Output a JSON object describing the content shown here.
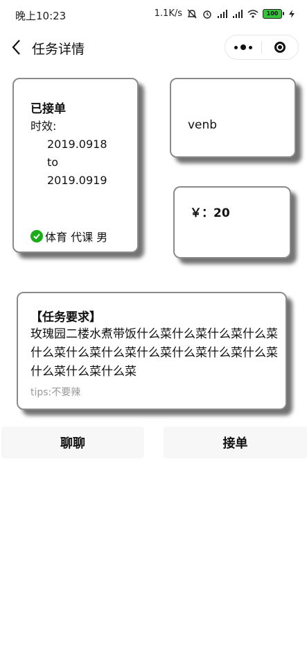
{
  "status_bar": {
    "time": "晚上10:23",
    "network_speed": "1.1K/s",
    "battery": "100"
  },
  "header": {
    "title": "任务详情"
  },
  "task": {
    "status": "已接单",
    "validity_label": "时效:",
    "date_start": "2019.0918",
    "date_to": "to",
    "date_end": "2019.0919",
    "tags": "体育 代课 男",
    "username": "venb",
    "price": "￥：20"
  },
  "requirements": {
    "title": "【任务要求】",
    "body": "玫瑰园二楼水煮带饭什么菜什么菜什么菜什么菜什么菜什么菜什么菜什么菜什么菜什么菜什么菜什么菜什么菜什么菜",
    "tips": "tips:不要辣"
  },
  "actions": {
    "chat": "聊聊",
    "accept": "接单"
  },
  "colors": {
    "check_green": "#1aad19",
    "battery_green": "#37c13d",
    "tips_gray": "#999999"
  }
}
